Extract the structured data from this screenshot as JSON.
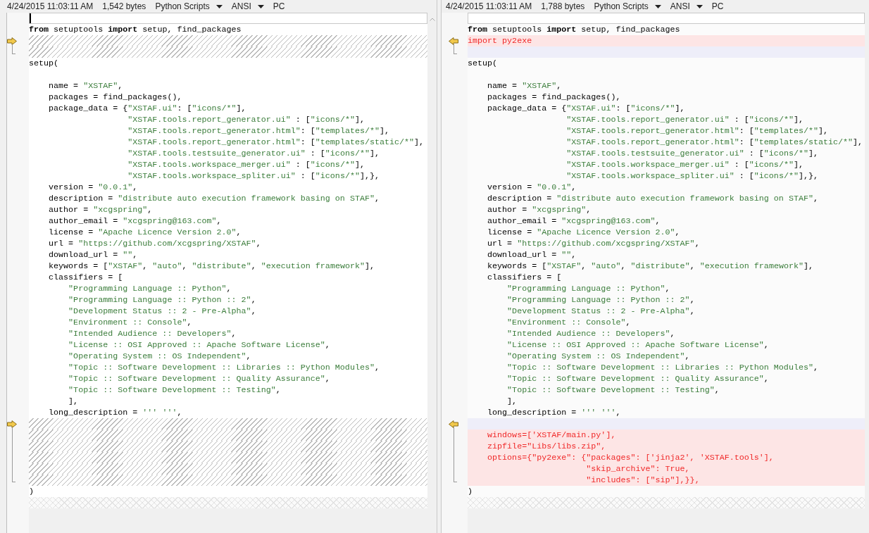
{
  "panes": [
    {
      "kind": "left",
      "header": {
        "timestamp": "4/24/2015 11:03:11 AM",
        "size": "1,542 bytes",
        "format": "Python Scripts",
        "encoding": "ANSI",
        "line_ending": "PC"
      },
      "lines": [
        {
          "kind": "current",
          "caret": true
        },
        {
          "kind": "normal",
          "text": "**from** setuptools **import** setup, find_packages"
        },
        {
          "kind": "gap",
          "marker": true
        },
        {
          "kind": "gap"
        },
        {
          "kind": "normal",
          "text": "setup("
        },
        {
          "kind": "empty"
        },
        {
          "kind": "normal",
          "text": "    name = \"XSTAF\","
        },
        {
          "kind": "normal",
          "text": "    packages = find_packages(),"
        },
        {
          "kind": "normal",
          "text": "    package_data = {\"XSTAF.ui\": [\"icons/*\"],"
        },
        {
          "kind": "normal",
          "text": "                    \"XSTAF.tools.report_generator.ui\" : [\"icons/*\"],"
        },
        {
          "kind": "normal",
          "text": "                    \"XSTAF.tools.report_generator.html\": [\"templates/*\"],"
        },
        {
          "kind": "normal",
          "text": "                    \"XSTAF.tools.report_generator.html\": [\"templates/static/*\"],"
        },
        {
          "kind": "normal",
          "text": "                    \"XSTAF.tools.testsuite_generator.ui\" : [\"icons/*\"],"
        },
        {
          "kind": "normal",
          "text": "                    \"XSTAF.tools.workspace_merger.ui\" : [\"icons/*\"],"
        },
        {
          "kind": "normal",
          "text": "                    \"XSTAF.tools.workspace_spliter.ui\" : [\"icons/*\"],},"
        },
        {
          "kind": "normal",
          "text": "    version = \"0.0.1\","
        },
        {
          "kind": "normal",
          "text": "    description = \"distribute auto execution framework basing on STAF\","
        },
        {
          "kind": "normal",
          "text": "    author = \"xcgspring\","
        },
        {
          "kind": "normal",
          "text": "    author_email = \"xcgspring@163.com\","
        },
        {
          "kind": "normal",
          "text": "    license = \"Apache Licence Version 2.0\","
        },
        {
          "kind": "normal",
          "text": "    url = \"https://github.com/xcgspring/XSTAF\","
        },
        {
          "kind": "normal",
          "text": "    download_url = \"\","
        },
        {
          "kind": "normal",
          "text": "    keywords = [\"XSTAF\", \"auto\", \"distribute\", \"execution framework\"],"
        },
        {
          "kind": "normal",
          "text": "    classifiers = ["
        },
        {
          "kind": "normal",
          "text": "        \"Programming Language :: Python\","
        },
        {
          "kind": "normal",
          "text": "        \"Programming Language :: Python :: 2\","
        },
        {
          "kind": "normal",
          "text": "        \"Development Status :: 2 - Pre-Alpha\","
        },
        {
          "kind": "normal",
          "text": "        \"Environment :: Console\","
        },
        {
          "kind": "normal",
          "text": "        \"Intended Audience :: Developers\","
        },
        {
          "kind": "normal",
          "text": "        \"License :: OSI Approved :: Apache Software License\","
        },
        {
          "kind": "normal",
          "text": "        \"Operating System :: OS Independent\","
        },
        {
          "kind": "normal",
          "text": "        \"Topic :: Software Development :: Libraries :: Python Modules\","
        },
        {
          "kind": "normal",
          "text": "        \"Topic :: Software Development :: Quality Assurance\","
        },
        {
          "kind": "normal",
          "text": "        \"Topic :: Software Development :: Testing\","
        },
        {
          "kind": "normal",
          "text": "        ],"
        },
        {
          "kind": "normal",
          "text": "    long_description = ''' ''',"
        },
        {
          "kind": "gap",
          "marker": true
        },
        {
          "kind": "gap"
        },
        {
          "kind": "gap"
        },
        {
          "kind": "gap"
        },
        {
          "kind": "gap"
        },
        {
          "kind": "gap"
        },
        {
          "kind": "normal",
          "text": ")"
        },
        {
          "kind": "end"
        }
      ]
    },
    {
      "kind": "right",
      "header": {
        "timestamp": "4/24/2015 11:03:11 AM",
        "size": "1,788 bytes",
        "format": "Python Scripts",
        "encoding": "ANSI",
        "line_ending": "PC"
      },
      "lines": [
        {
          "kind": "current"
        },
        {
          "kind": "normal",
          "text": "**from** setuptools **import** setup, find_packages"
        },
        {
          "kind": "added",
          "text": "import py2exe",
          "marker": true
        },
        {
          "kind": "blank"
        },
        {
          "kind": "normal",
          "text": "setup("
        },
        {
          "kind": "empty"
        },
        {
          "kind": "normal",
          "text": "    name = \"XSTAF\","
        },
        {
          "kind": "normal",
          "text": "    packages = find_packages(),"
        },
        {
          "kind": "normal",
          "text": "    package_data = {\"XSTAF.ui\": [\"icons/*\"],"
        },
        {
          "kind": "normal",
          "text": "                    \"XSTAF.tools.report_generator.ui\" : [\"icons/*\"],"
        },
        {
          "kind": "normal",
          "text": "                    \"XSTAF.tools.report_generator.html\": [\"templates/*\"],"
        },
        {
          "kind": "normal",
          "text": "                    \"XSTAF.tools.report_generator.html\": [\"templates/static/*\"],"
        },
        {
          "kind": "normal",
          "text": "                    \"XSTAF.tools.testsuite_generator.ui\" : [\"icons/*\"],"
        },
        {
          "kind": "normal",
          "text": "                    \"XSTAF.tools.workspace_merger.ui\" : [\"icons/*\"],"
        },
        {
          "kind": "normal",
          "text": "                    \"XSTAF.tools.workspace_spliter.ui\" : [\"icons/*\"],},"
        },
        {
          "kind": "normal",
          "text": "    version = \"0.0.1\","
        },
        {
          "kind": "normal",
          "text": "    description = \"distribute auto execution framework basing on STAF\","
        },
        {
          "kind": "normal",
          "text": "    author = \"xcgspring\","
        },
        {
          "kind": "normal",
          "text": "    author_email = \"xcgspring@163.com\","
        },
        {
          "kind": "normal",
          "text": "    license = \"Apache Licence Version 2.0\","
        },
        {
          "kind": "normal",
          "text": "    url = \"https://github.com/xcgspring/XSTAF\","
        },
        {
          "kind": "normal",
          "text": "    download_url = \"\","
        },
        {
          "kind": "normal",
          "text": "    keywords = [\"XSTAF\", \"auto\", \"distribute\", \"execution framework\"],"
        },
        {
          "kind": "normal",
          "text": "    classifiers = ["
        },
        {
          "kind": "normal",
          "text": "        \"Programming Language :: Python\","
        },
        {
          "kind": "normal",
          "text": "        \"Programming Language :: Python :: 2\","
        },
        {
          "kind": "normal",
          "text": "        \"Development Status :: 2 - Pre-Alpha\","
        },
        {
          "kind": "normal",
          "text": "        \"Environment :: Console\","
        },
        {
          "kind": "normal",
          "text": "        \"Intended Audience :: Developers\","
        },
        {
          "kind": "normal",
          "text": "        \"License :: OSI Approved :: Apache Software License\","
        },
        {
          "kind": "normal",
          "text": "        \"Operating System :: OS Independent\","
        },
        {
          "kind": "normal",
          "text": "        \"Topic :: Software Development :: Libraries :: Python Modules\","
        },
        {
          "kind": "normal",
          "text": "        \"Topic :: Software Development :: Quality Assurance\","
        },
        {
          "kind": "normal",
          "text": "        \"Topic :: Software Development :: Testing\","
        },
        {
          "kind": "normal",
          "text": "        ],"
        },
        {
          "kind": "normal",
          "text": "    long_description = ''' ''',"
        },
        {
          "kind": "blank",
          "marker": true
        },
        {
          "kind": "added",
          "text": "    windows=['XSTAF/main.py'],"
        },
        {
          "kind": "added",
          "text": "    zipfile=\"Libs/libs.zip\","
        },
        {
          "kind": "added",
          "text": "    options={\"py2exe\": {\"packages\": ['jinja2', 'XSTAF.tools'],"
        },
        {
          "kind": "added",
          "text": "                        \"skip_archive\": True,"
        },
        {
          "kind": "added",
          "text": "                        \"includes\": [\"sip\"],}},"
        },
        {
          "kind": "normal",
          "text": ")"
        },
        {
          "kind": "end"
        }
      ]
    }
  ]
}
